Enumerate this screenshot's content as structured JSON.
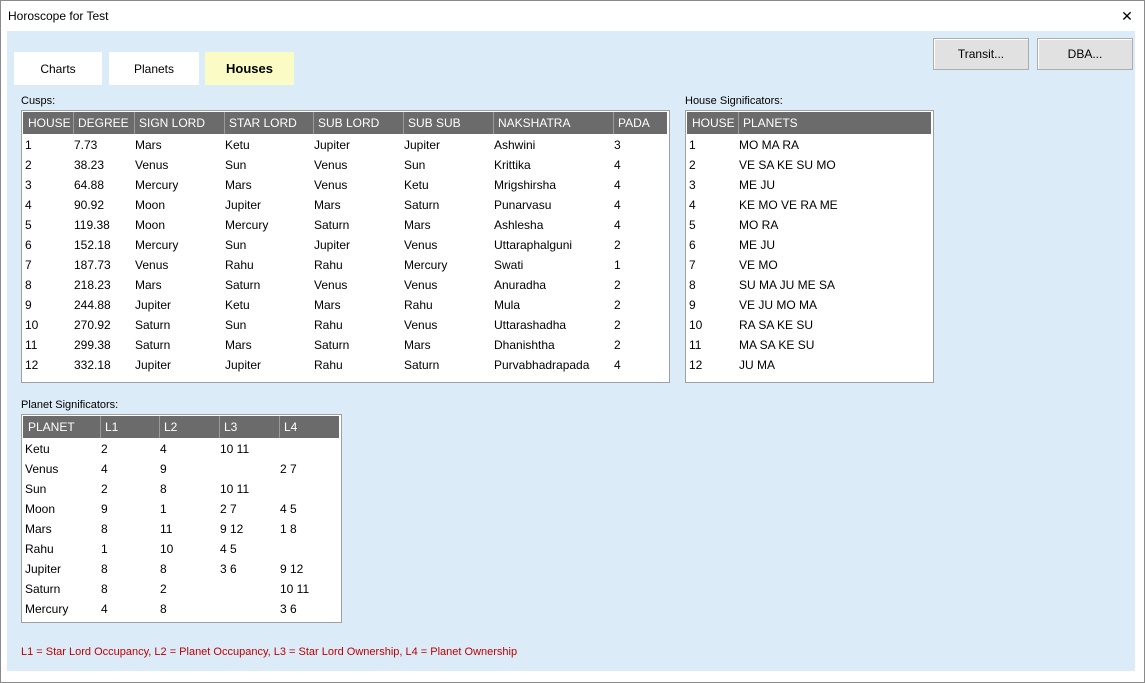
{
  "window": {
    "title": "Horoscope for Test",
    "close_symbol": "✕"
  },
  "tabs": [
    {
      "label": "Charts",
      "active": false
    },
    {
      "label": "Planets",
      "active": false
    },
    {
      "label": "Houses",
      "active": true
    }
  ],
  "buttons": {
    "transit": "Transit...",
    "dba": "DBA..."
  },
  "cusps": {
    "label": "Cusps:",
    "columns": [
      "HOUSE",
      "DEGREE",
      "SIGN LORD",
      "STAR LORD",
      "SUB LORD",
      "SUB SUB LORD",
      "NAKSHATRA",
      "PADA"
    ],
    "rows": [
      [
        "1",
        "7.73",
        "Mars",
        "Ketu",
        "Jupiter",
        "Jupiter",
        "Ashwini",
        "3"
      ],
      [
        "2",
        "38.23",
        "Venus",
        "Sun",
        "Venus",
        "Sun",
        "Krittika",
        "4"
      ],
      [
        "3",
        "64.88",
        "Mercury",
        "Mars",
        "Venus",
        "Ketu",
        "Mrigshirsha",
        "4"
      ],
      [
        "4",
        "90.92",
        "Moon",
        "Jupiter",
        "Mars",
        "Saturn",
        "Punarvasu",
        "4"
      ],
      [
        "5",
        "119.38",
        "Moon",
        "Mercury",
        "Saturn",
        "Mars",
        "Ashlesha",
        "4"
      ],
      [
        "6",
        "152.18",
        "Mercury",
        "Sun",
        "Jupiter",
        "Venus",
        "Uttaraphalguni",
        "2"
      ],
      [
        "7",
        "187.73",
        "Venus",
        "Rahu",
        "Rahu",
        "Mercury",
        "Swati",
        "1"
      ],
      [
        "8",
        "218.23",
        "Mars",
        "Saturn",
        "Venus",
        "Venus",
        "Anuradha",
        "2"
      ],
      [
        "9",
        "244.88",
        "Jupiter",
        "Ketu",
        "Mars",
        "Rahu",
        "Mula",
        "2"
      ],
      [
        "10",
        "270.92",
        "Saturn",
        "Sun",
        "Rahu",
        "Venus",
        "Uttarashadha",
        "2"
      ],
      [
        "11",
        "299.38",
        "Saturn",
        "Mars",
        "Saturn",
        "Mars",
        "Dhanishtha",
        "2"
      ],
      [
        "12",
        "332.18",
        "Jupiter",
        "Jupiter",
        "Rahu",
        "Saturn",
        "Purvabhadrapada",
        "4"
      ]
    ]
  },
  "house_significators": {
    "label": "House Significators:",
    "columns": [
      "HOUSE",
      "PLANETS"
    ],
    "rows": [
      [
        "1",
        "MO MA RA"
      ],
      [
        "2",
        "VE SA KE SU MO"
      ],
      [
        "3",
        "ME JU"
      ],
      [
        "4",
        "KE MO VE RA ME"
      ],
      [
        "5",
        "MO RA"
      ],
      [
        "6",
        "ME JU"
      ],
      [
        "7",
        "VE MO"
      ],
      [
        "8",
        "SU MA JU ME SA"
      ],
      [
        "9",
        "VE JU MO MA"
      ],
      [
        "10",
        "RA SA KE SU"
      ],
      [
        "11",
        "MA SA KE SU"
      ],
      [
        "12",
        "JU MA"
      ]
    ]
  },
  "planet_significators": {
    "label": "Planet Significators:",
    "columns": [
      "PLANET",
      "L1",
      "L2",
      "L3",
      "L4"
    ],
    "rows": [
      [
        "Ketu",
        "2",
        "4",
        "10 11",
        ""
      ],
      [
        "Venus",
        "4",
        "9",
        "",
        "2 7"
      ],
      [
        "Sun",
        "2",
        "8",
        "10 11",
        ""
      ],
      [
        "Moon",
        "9",
        "1",
        "2 7",
        "4 5"
      ],
      [
        "Mars",
        "8",
        "11",
        "9 12",
        "1 8"
      ],
      [
        "Rahu",
        "1",
        "10",
        "4 5",
        ""
      ],
      [
        "Jupiter",
        "8",
        "8",
        "3 6",
        "9 12"
      ],
      [
        "Saturn",
        "8",
        "2",
        "",
        "10 11"
      ],
      [
        "Mercury",
        "4",
        "8",
        "",
        "3 6"
      ]
    ]
  },
  "legend": "L1 = Star Lord Occupancy, L2 = Planet Occupancy, L3 = Star Lord Ownership, L4 = Planet Ownership",
  "colors": {
    "accent_tab": "#fbfbc6",
    "header_bg": "#6b6b6b",
    "legend_text": "#c00000",
    "client_bg": "#dcebf8"
  }
}
